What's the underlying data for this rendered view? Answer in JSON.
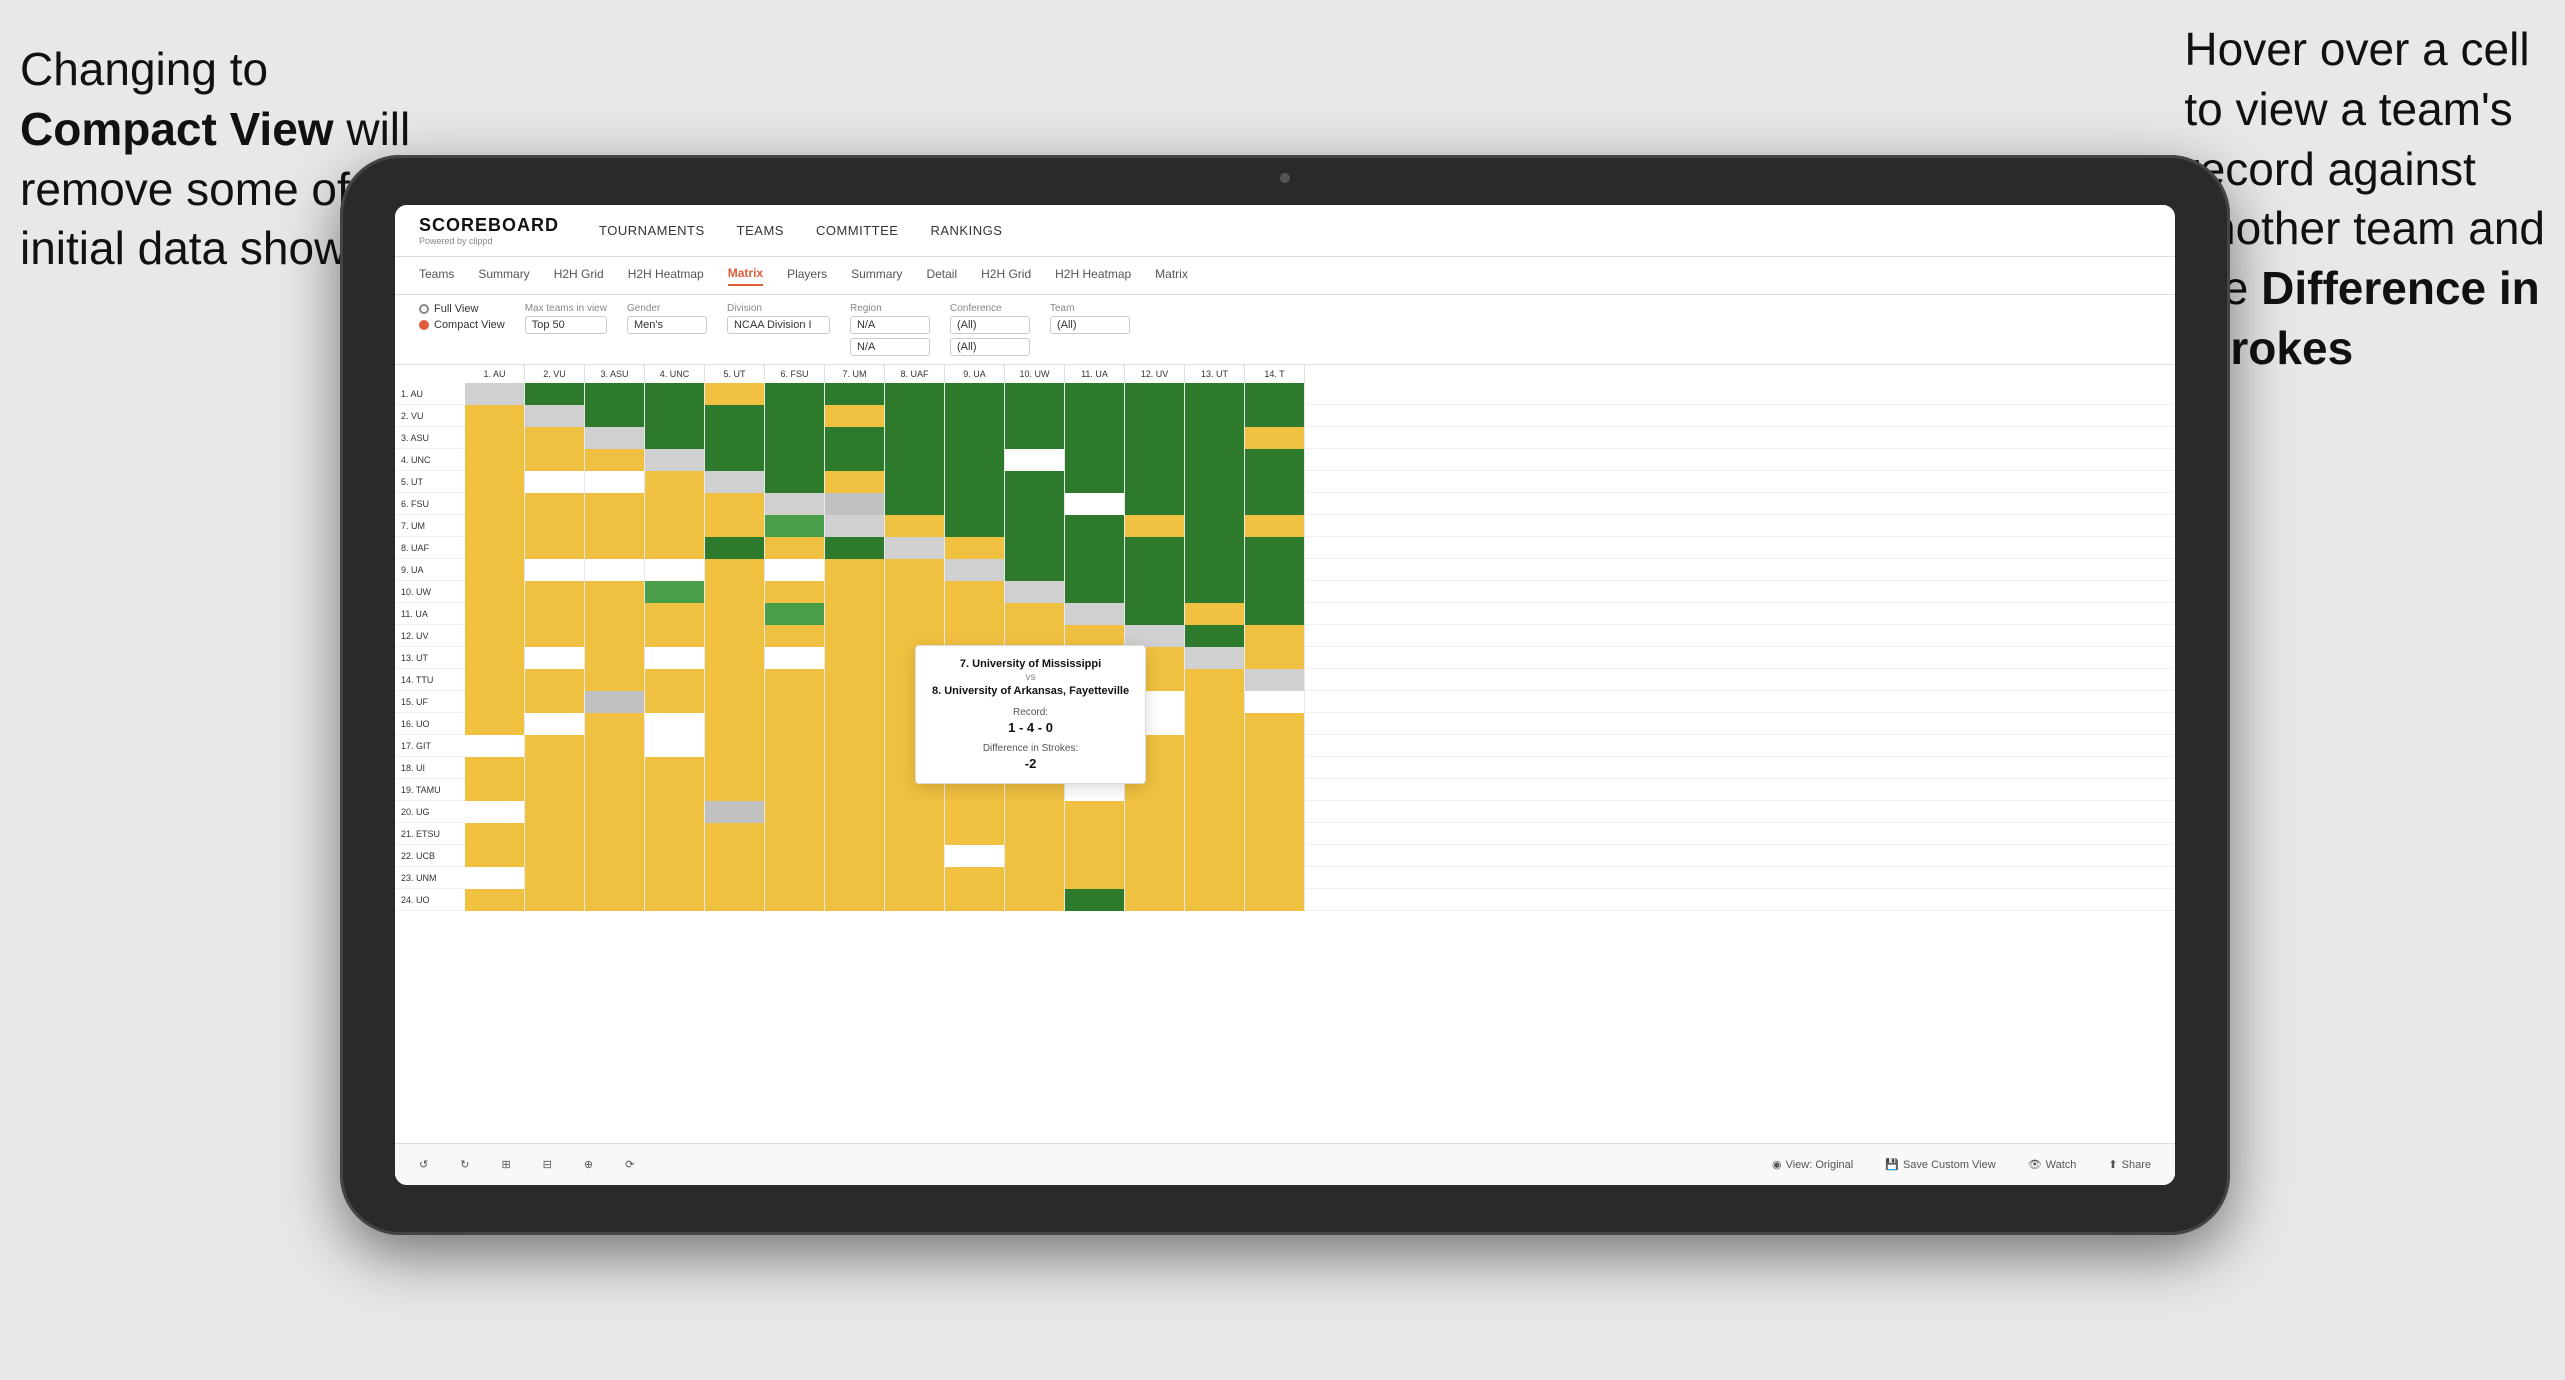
{
  "annotations": {
    "left": {
      "line1": "Changing to",
      "line2_bold": "Compact View",
      "line2_end": " will",
      "line3": "remove some of the",
      "line4": "initial data shown"
    },
    "right": {
      "line1": "Hover over a cell",
      "line2": "to view a team's",
      "line3": "record against",
      "line4": "another team and",
      "line5_start": "the ",
      "line5_bold": "Difference in",
      "line6": "Strokes"
    }
  },
  "nav": {
    "logo": "SCOREBOARD",
    "logo_sub": "Powered by clippd",
    "items": [
      "TOURNAMENTS",
      "TEAMS",
      "COMMITTEE",
      "RANKINGS"
    ]
  },
  "sub_nav": {
    "items": [
      "Teams",
      "Summary",
      "H2H Grid",
      "H2H Heatmap",
      "Matrix",
      "Players",
      "Summary",
      "Detail",
      "H2H Grid",
      "H2H Heatmap",
      "Matrix"
    ],
    "active": "Matrix"
  },
  "controls": {
    "view_full": "Full View",
    "view_compact": "Compact View",
    "max_teams_label": "Max teams in view",
    "max_teams_value": "Top 50",
    "gender_label": "Gender",
    "gender_value": "Men's",
    "division_label": "Division",
    "division_value": "NCAA Division I",
    "region_label": "Region",
    "region_value1": "N/A",
    "region_value2": "N/A",
    "conference_label": "Conference",
    "conference_value1": "(All)",
    "conference_value2": "(All)",
    "team_label": "Team",
    "team_value": "(All)"
  },
  "col_headers": [
    "1. AU",
    "2. VU",
    "3. ASU",
    "4. UNC",
    "5. UT",
    "6. FSU",
    "7. UM",
    "8. UAF",
    "9. UA",
    "10. UW",
    "11. UA",
    "12. UV",
    "13. UT",
    "14. T"
  ],
  "rows": [
    {
      "label": "1. AU",
      "cells": [
        "diagonal",
        "green-dark",
        "green-dark",
        "green-dark",
        "yellow",
        "green-dark",
        "green-dark",
        "green-dark",
        "green-dark",
        "green-dark",
        "green-dark",
        "green-dark",
        "green-dark",
        "green-dark"
      ]
    },
    {
      "label": "2. VU",
      "cells": [
        "yellow",
        "diagonal",
        "green-dark",
        "green-dark",
        "green-dark",
        "green-dark",
        "yellow",
        "green-dark",
        "green-dark",
        "green-dark",
        "green-dark",
        "green-dark",
        "green-dark",
        "green-dark"
      ]
    },
    {
      "label": "3. ASU",
      "cells": [
        "yellow",
        "yellow",
        "diagonal",
        "green-dark",
        "green-dark",
        "green-dark",
        "green-dark",
        "green-dark",
        "green-dark",
        "green-dark",
        "green-dark",
        "green-dark",
        "green-dark",
        "yellow"
      ]
    },
    {
      "label": "4. UNC",
      "cells": [
        "yellow",
        "yellow",
        "yellow",
        "diagonal",
        "green-dark",
        "green-dark",
        "green-dark",
        "green-dark",
        "green-dark",
        "white",
        "green-dark",
        "green-dark",
        "green-dark",
        "green-dark"
      ]
    },
    {
      "label": "5. UT",
      "cells": [
        "yellow",
        "white",
        "white",
        "yellow",
        "diagonal",
        "green-dark",
        "yellow",
        "green-dark",
        "green-dark",
        "green-dark",
        "green-dark",
        "green-dark",
        "green-dark",
        "green-dark"
      ]
    },
    {
      "label": "6. FSU",
      "cells": [
        "yellow",
        "yellow",
        "yellow",
        "yellow",
        "yellow",
        "diagonal",
        "gray",
        "green-dark",
        "green-dark",
        "green-dark",
        "white",
        "green-dark",
        "green-dark",
        "green-dark"
      ]
    },
    {
      "label": "7. UM",
      "cells": [
        "yellow",
        "yellow",
        "yellow",
        "yellow",
        "yellow",
        "green-mid",
        "diagonal",
        "yellow",
        "green-dark",
        "green-dark",
        "green-dark",
        "yellow",
        "green-dark",
        "yellow"
      ]
    },
    {
      "label": "8. UAF",
      "cells": [
        "yellow",
        "yellow",
        "yellow",
        "yellow",
        "green-dark",
        "yellow",
        "green-dark",
        "diagonal",
        "yellow",
        "green-dark",
        "green-dark",
        "green-dark",
        "green-dark",
        "green-dark"
      ]
    },
    {
      "label": "9. UA",
      "cells": [
        "yellow",
        "white",
        "white",
        "white",
        "yellow",
        "white",
        "yellow",
        "yellow",
        "diagonal",
        "green-dark",
        "green-dark",
        "green-dark",
        "green-dark",
        "green-dark"
      ]
    },
    {
      "label": "10. UW",
      "cells": [
        "yellow",
        "yellow",
        "yellow",
        "green-mid",
        "yellow",
        "yellow",
        "yellow",
        "yellow",
        "yellow",
        "diagonal",
        "green-dark",
        "green-dark",
        "green-dark",
        "green-dark"
      ]
    },
    {
      "label": "11. UA",
      "cells": [
        "yellow",
        "yellow",
        "yellow",
        "yellow",
        "yellow",
        "green-mid",
        "yellow",
        "yellow",
        "yellow",
        "yellow",
        "diagonal",
        "green-dark",
        "yellow",
        "green-dark"
      ]
    },
    {
      "label": "12. UV",
      "cells": [
        "yellow",
        "yellow",
        "yellow",
        "yellow",
        "yellow",
        "yellow",
        "yellow",
        "yellow",
        "yellow",
        "yellow",
        "yellow",
        "diagonal",
        "green-dark",
        "yellow"
      ]
    },
    {
      "label": "13. UT",
      "cells": [
        "yellow",
        "white",
        "yellow",
        "white",
        "yellow",
        "white",
        "yellow",
        "yellow",
        "yellow",
        "yellow",
        "yellow",
        "yellow",
        "diagonal",
        "yellow"
      ]
    },
    {
      "label": "14. TTU",
      "cells": [
        "yellow",
        "yellow",
        "yellow",
        "yellow",
        "yellow",
        "yellow",
        "yellow",
        "yellow",
        "yellow",
        "yellow",
        "yellow",
        "yellow",
        "yellow",
        "diagonal"
      ]
    },
    {
      "label": "15. UF",
      "cells": [
        "yellow",
        "yellow",
        "gray",
        "yellow",
        "yellow",
        "yellow",
        "yellow",
        "yellow",
        "yellow",
        "yellow",
        "yellow",
        "white",
        "yellow",
        "white"
      ]
    },
    {
      "label": "16. UO",
      "cells": [
        "yellow",
        "white",
        "yellow",
        "white",
        "yellow",
        "yellow",
        "yellow",
        "yellow",
        "yellow",
        "white",
        "yellow",
        "white",
        "yellow",
        "yellow"
      ]
    },
    {
      "label": "17. GIT",
      "cells": [
        "white",
        "yellow",
        "yellow",
        "white",
        "yellow",
        "yellow",
        "yellow",
        "yellow",
        "yellow",
        "yellow",
        "yellow",
        "yellow",
        "yellow",
        "yellow"
      ]
    },
    {
      "label": "18. UI",
      "cells": [
        "yellow",
        "yellow",
        "yellow",
        "yellow",
        "yellow",
        "yellow",
        "yellow",
        "yellow",
        "yellow",
        "yellow",
        "yellow",
        "yellow",
        "yellow",
        "yellow"
      ]
    },
    {
      "label": "19. TAMU",
      "cells": [
        "yellow",
        "yellow",
        "yellow",
        "yellow",
        "yellow",
        "yellow",
        "yellow",
        "yellow",
        "yellow",
        "yellow",
        "white",
        "yellow",
        "yellow",
        "yellow"
      ]
    },
    {
      "label": "20. UG",
      "cells": [
        "white",
        "yellow",
        "yellow",
        "yellow",
        "gray",
        "yellow",
        "yellow",
        "yellow",
        "yellow",
        "yellow",
        "yellow",
        "yellow",
        "yellow",
        "yellow"
      ]
    },
    {
      "label": "21. ETSU",
      "cells": [
        "yellow",
        "yellow",
        "yellow",
        "yellow",
        "yellow",
        "yellow",
        "yellow",
        "yellow",
        "yellow",
        "yellow",
        "yellow",
        "yellow",
        "yellow",
        "yellow"
      ]
    },
    {
      "label": "22. UCB",
      "cells": [
        "yellow",
        "yellow",
        "yellow",
        "yellow",
        "yellow",
        "yellow",
        "yellow",
        "yellow",
        "white",
        "yellow",
        "yellow",
        "yellow",
        "yellow",
        "yellow"
      ]
    },
    {
      "label": "23. UNM",
      "cells": [
        "white",
        "yellow",
        "yellow",
        "yellow",
        "yellow",
        "yellow",
        "yellow",
        "yellow",
        "yellow",
        "yellow",
        "yellow",
        "yellow",
        "yellow",
        "yellow"
      ]
    },
    {
      "label": "24. UO",
      "cells": [
        "yellow",
        "yellow",
        "yellow",
        "yellow",
        "yellow",
        "yellow",
        "yellow",
        "yellow",
        "yellow",
        "yellow",
        "green-dark",
        "yellow",
        "yellow",
        "yellow"
      ]
    }
  ],
  "tooltip": {
    "team1": "7. University of Mississippi",
    "vs": "vs",
    "team2": "8. University of Arkansas, Fayetteville",
    "record_label": "Record:",
    "record": "1 - 4 - 0",
    "strokes_label": "Difference in Strokes:",
    "strokes": "-2"
  },
  "toolbar": {
    "undo": "↺",
    "redo": "↻",
    "icon1": "⊞",
    "icon2": "⊟",
    "icon3": "⊕",
    "view_original": "View: Original",
    "save_custom": "Save Custom View",
    "watch": "Watch",
    "share": "Share"
  }
}
